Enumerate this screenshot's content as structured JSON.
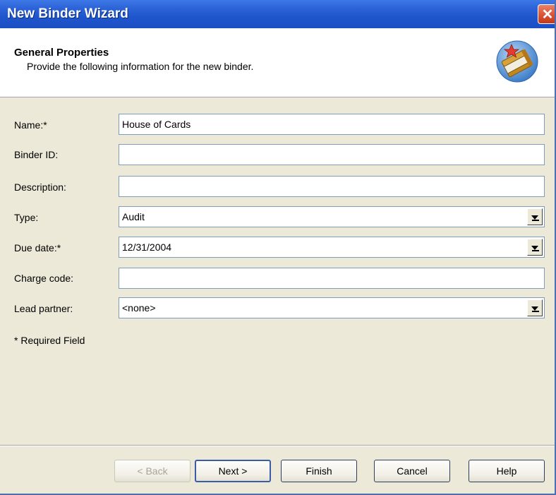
{
  "window": {
    "title": "New Binder Wizard",
    "close_symbol": "✕"
  },
  "header": {
    "title": "General Properties",
    "subtitle": "Provide the following information for the new binder.",
    "icon": "binder-book-icon"
  },
  "form": {
    "name": {
      "label": "Name:*",
      "value": "House of Cards"
    },
    "binder_id": {
      "label": "Binder ID:",
      "value": ""
    },
    "description": {
      "label": "Description:",
      "value": ""
    },
    "type": {
      "label": "Type:",
      "value": "Audit"
    },
    "due_date": {
      "label": "Due date:*",
      "value": "12/31/2004"
    },
    "charge_code": {
      "label": "Charge code:",
      "value": ""
    },
    "lead_partner": {
      "label": "Lead partner:",
      "value": "<none>"
    },
    "required_note": "* Required Field"
  },
  "buttons": {
    "back": "< Back",
    "next": "Next >",
    "finish": "Finish",
    "cancel": "Cancel",
    "help": "Help"
  },
  "colors": {
    "titlebar": "#2c63d8",
    "dialog_bg": "#ece9d8",
    "field_border": "#7f9db9",
    "close_button": "#d95435"
  }
}
